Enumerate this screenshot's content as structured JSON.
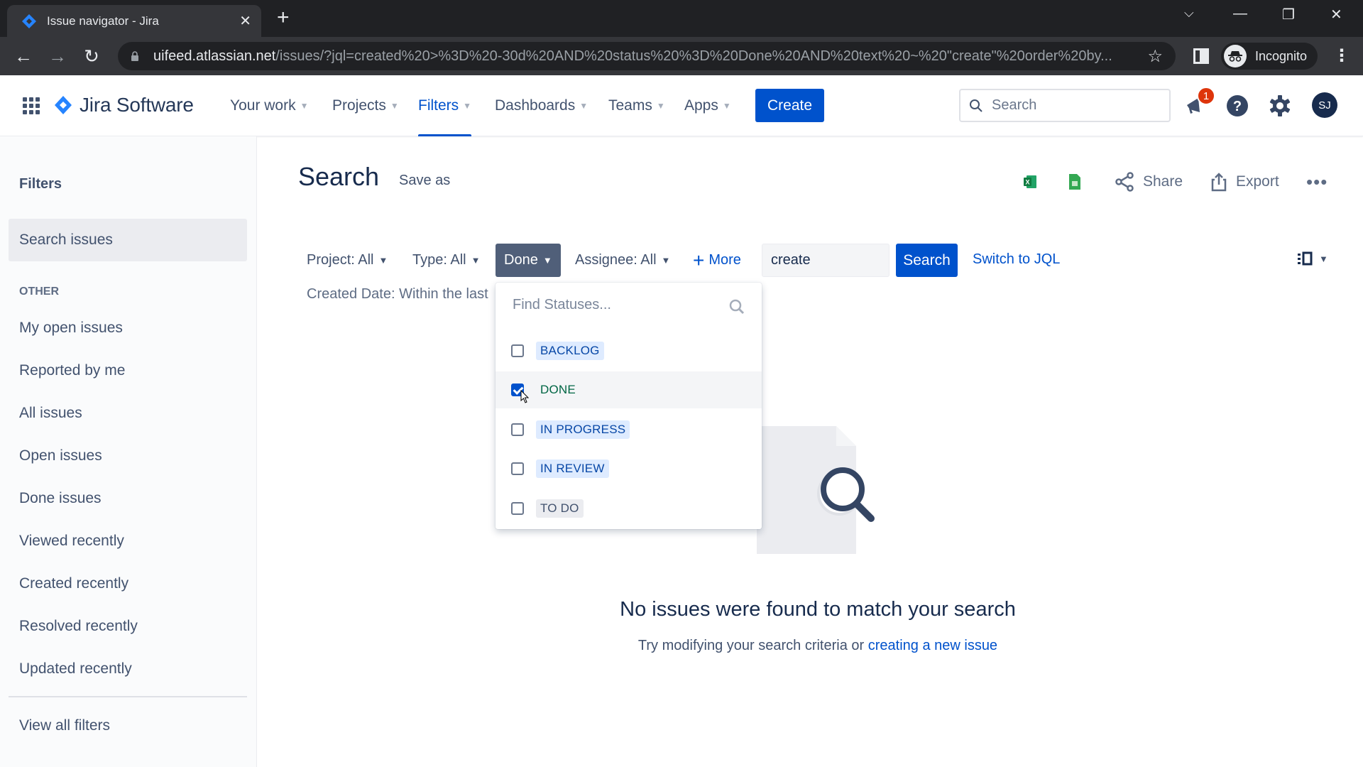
{
  "browser": {
    "tab_title": "Issue navigator - Jira",
    "url_host": "uifeed.atlassian.net",
    "url_path": "/issues/?jql=created%20>%3D%20-30d%20AND%20status%20%3D%20Done%20AND%20text%20~%20\"create\"%20order%20by...",
    "profile_label": "Incognito"
  },
  "topnav": {
    "product_name": "Jira Software",
    "items": [
      {
        "label": "Your work",
        "active": false
      },
      {
        "label": "Projects",
        "active": false
      },
      {
        "label": "Filters",
        "active": true
      },
      {
        "label": "Dashboards",
        "active": false
      },
      {
        "label": "Teams",
        "active": false
      },
      {
        "label": "Apps",
        "active": false
      }
    ],
    "create_label": "Create",
    "search_placeholder": "Search",
    "notification_count": "1",
    "avatar_initials": "SJ"
  },
  "sidebar": {
    "heading": "Filters",
    "selected_item": "Search issues",
    "section_label": "OTHER",
    "items": [
      "My open issues",
      "Reported by me",
      "All issues",
      "Open issues",
      "Done issues",
      "Viewed recently",
      "Created recently",
      "Resolved recently",
      "Updated recently"
    ],
    "footer_link": "View all filters"
  },
  "main": {
    "title": "Search",
    "save_as": "Save as",
    "actions": {
      "excel_icon": "excel-icon",
      "sheets_icon": "google-sheets-icon",
      "share": "Share",
      "export": "Export"
    },
    "filters": {
      "project": "Project: All",
      "type": "Type: All",
      "status": "Done",
      "assignee": "Assignee: All",
      "more": "More"
    },
    "text_search_value": "create",
    "search_button": "Search",
    "switch_jql": "Switch to JQL",
    "created_date_filter": "Created Date: Within the last"
  },
  "status_dropdown": {
    "placeholder": "Find Statuses...",
    "options": [
      {
        "label": "BACKLOG",
        "checked": false,
        "color": "#0747a6"
      },
      {
        "label": "DONE",
        "checked": true,
        "color": "#006644"
      },
      {
        "label": "IN PROGRESS",
        "checked": false,
        "color": "#0747a6"
      },
      {
        "label": "IN REVIEW",
        "checked": false,
        "color": "#0747a6"
      },
      {
        "label": "TO DO",
        "checked": false,
        "color": "#42526e"
      }
    ]
  },
  "empty_state": {
    "title": "No issues were found to match your search",
    "subtitle_prefix": "Try modifying your search criteria or ",
    "subtitle_link": "creating a new issue"
  }
}
